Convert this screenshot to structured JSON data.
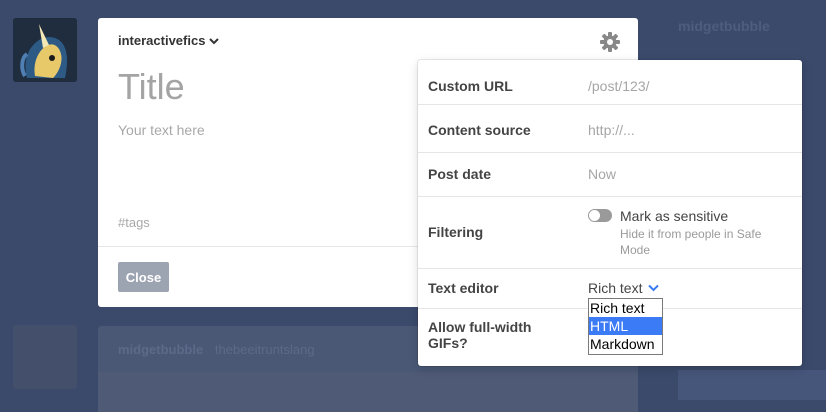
{
  "background": {
    "blog_name": "midgetbubble",
    "post_blog_name": "midgetbubble",
    "post_reblog_name": "thebeeitruntslang"
  },
  "composer": {
    "blog_name": "interactivefics",
    "title_placeholder": "Title",
    "body_placeholder": "Your text here",
    "tags_placeholder": "#tags",
    "close_label": "Close"
  },
  "settings": {
    "custom_url_label": "Custom URL",
    "custom_url_placeholder": "/post/123/",
    "content_source_label": "Content source",
    "content_source_placeholder": "http://...",
    "post_date_label": "Post date",
    "post_date_value": "Now",
    "filtering_label": "Filtering",
    "sensitive_label": "Mark as sensitive",
    "sensitive_hint": "Hide it from people in Safe Mode",
    "sensitive_on": false,
    "text_editor_label": "Text editor",
    "text_editor_value": "Rich text",
    "full_width_label": "Allow full-width GIFs?"
  },
  "editor_dropdown": {
    "options": [
      "Rich text",
      "HTML",
      "Markdown"
    ],
    "highlighted": "HTML"
  },
  "colors": {
    "backdrop": "#3b4a6b",
    "highlight": "#3b7bf5",
    "close_button": "#9da4b1"
  }
}
